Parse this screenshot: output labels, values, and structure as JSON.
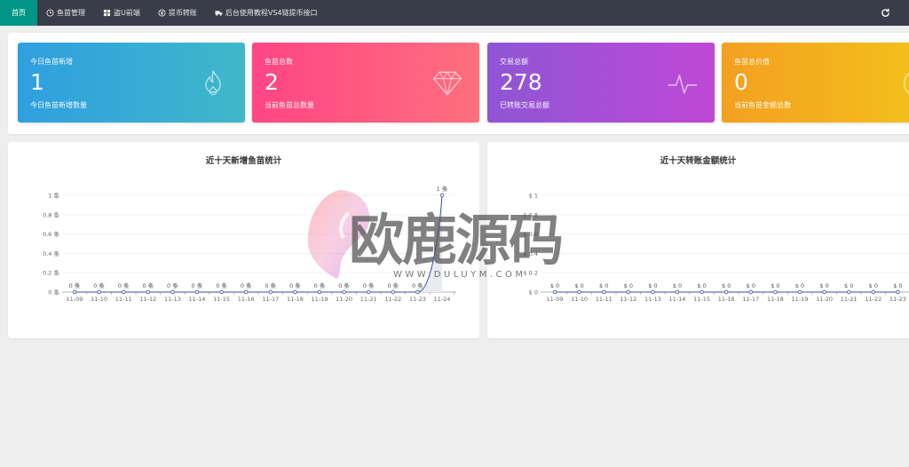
{
  "nav": {
    "items": [
      {
        "label": "首页",
        "icon": "none"
      },
      {
        "label": "鱼苗管理",
        "icon": "clock-icon"
      },
      {
        "label": "盗U前端",
        "icon": "windows-icon"
      },
      {
        "label": "提币转账",
        "icon": "yen-coin-icon"
      },
      {
        "label": "后台使用教程VS4链提币接口",
        "icon": "truck-icon"
      }
    ],
    "refresh_icon": "refresh-icon"
  },
  "stats": [
    {
      "label": "今日鱼苗新增",
      "value": "1",
      "sub": "今日鱼苗新增数量",
      "icon": "flame-icon"
    },
    {
      "label": "鱼苗总数",
      "value": "2",
      "sub": "当前鱼苗总数量",
      "icon": "diamond-icon"
    },
    {
      "label": "交易总额",
      "value": "278",
      "sub": "已转账交易总额",
      "icon": "pulse-icon"
    },
    {
      "label": "鱼苗总价值",
      "value": "0",
      "sub": "当前鱼苗金额总数",
      "icon": "coin-icon"
    }
  ],
  "charts": {
    "left_title": "近十天新增鱼苗统计",
    "right_title": "近十天转账金额统计"
  },
  "chart_data": [
    {
      "type": "line",
      "title": "近十天新增鱼苗统计",
      "categories": [
        "11-09",
        "11-10",
        "11-11",
        "11-12",
        "11-13",
        "11-14",
        "11-15",
        "11-16",
        "11-17",
        "11-18",
        "11-19",
        "11-20",
        "11-21",
        "11-22",
        "11-23",
        "11-24"
      ],
      "values": [
        0,
        0,
        0,
        0,
        0,
        0,
        0,
        0,
        0,
        0,
        0,
        0,
        0,
        0,
        0,
        1
      ],
      "point_labels": [
        "0 条",
        "0 条",
        "0 条",
        "0 条",
        "0 条",
        "0 条",
        "0 条",
        "0 条",
        "0 条",
        "0 条",
        "0 条",
        "0 条",
        "0 条",
        "0 条",
        "0 条",
        "1 条"
      ],
      "y_ticks": [
        "0 条",
        "0.2 条",
        "0.4 条",
        "0.6 条",
        "0.8 条",
        "1 条"
      ],
      "ylim": [
        0,
        1
      ],
      "grid": true,
      "color": "#3b4ea3"
    },
    {
      "type": "line",
      "title": "近十天转账金额统计",
      "categories": [
        "11-09",
        "11-10",
        "11-11",
        "11-12",
        "11-13",
        "11-14",
        "11-15",
        "11-16",
        "11-17",
        "11-18",
        "11-19",
        "11-20",
        "11-21",
        "11-22",
        "11-23"
      ],
      "values": [
        0,
        0,
        0,
        0,
        0,
        0,
        0,
        0,
        0,
        0,
        0,
        0,
        0,
        0,
        0
      ],
      "point_labels": [
        "$ 0",
        "$ 0",
        "$ 0",
        "$ 0",
        "$ 0",
        "$ 0",
        "$ 0",
        "$ 0",
        "$ 0",
        "$ 0",
        "$ 0",
        "$ 0",
        "$ 0",
        "$ 0",
        "$ 0"
      ],
      "y_ticks": [
        "$ 0",
        "$ 0.2",
        "$ 0.4",
        "$ 0.6",
        "$ 0.8",
        "$ 1"
      ],
      "ylim": [
        0,
        1
      ],
      "grid": true,
      "color": "#3b4ea3"
    }
  ],
  "watermark": {
    "text": "欧鹿源码",
    "url": "WWW.DULUYM.COM"
  }
}
